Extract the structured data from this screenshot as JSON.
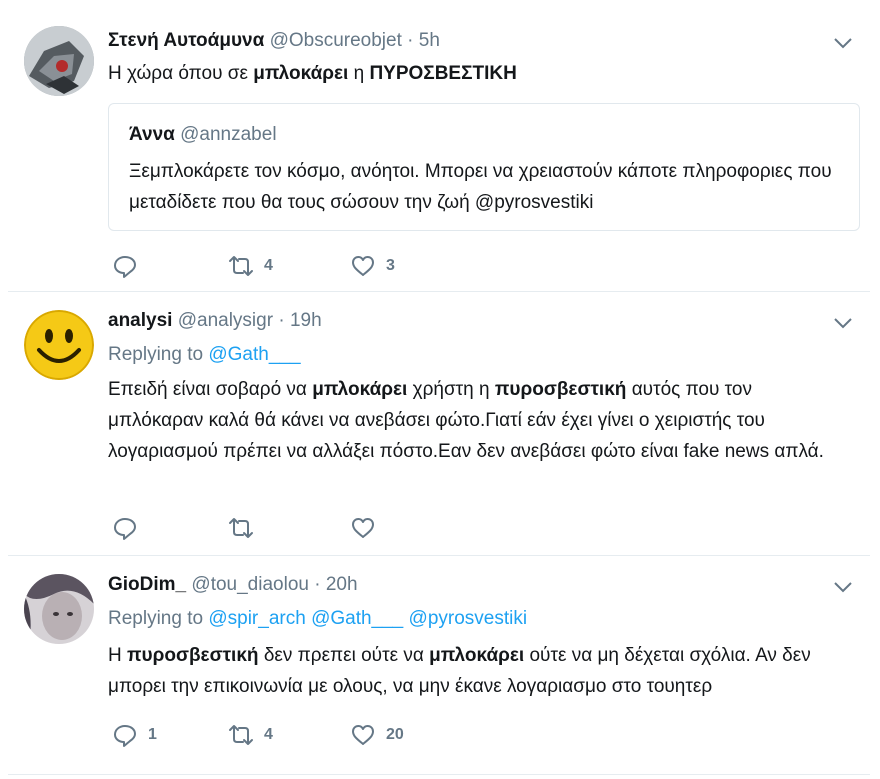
{
  "tweets": [
    {
      "name": "Στενή Αυτοάμυνα",
      "handle": "@Obscureobjet",
      "dot": "·",
      "time": "5h",
      "text_parts": [
        "Η χώρα όπου σε ",
        "μπλοκάρει",
        " η ",
        "ΠΥΡΟΣΒΕΣΤΙΚΗ"
      ],
      "quote": {
        "name": "Άννα",
        "handle": "@annzabel",
        "text": "Ξεμπλοκάρετε τον κόσμο, ανόητοι. Μπορει να χρειαστούν κάποτε πληροφοριες που μεταδίδετε που θα τους σώσουν την ζωή @pyrosvestiki"
      },
      "actions": {
        "reply_count": "",
        "retweet_count": "4",
        "like_count": "3"
      }
    },
    {
      "name": "analysi",
      "handle": "@analysigr",
      "dot": "·",
      "time": "19h",
      "replying_prefix": "Replying to",
      "replying_to": [
        "@Gath___"
      ],
      "text_parts": [
        "Επειδή είναι σοβαρό να ",
        "μπλοκάρει",
        " χρήστη η ",
        "πυροσβεστική",
        " αυτός που τον μπλόκαραν καλά θά κάνει να ανεβάσει φώτο.Γιατί εάν έχει γίνει ο χειριστής του λογαριασμού πρέπει να αλλάξει πόστο.Εαν δεν ανεβάσει φώτο είναι fake news απλά."
      ],
      "actions": {
        "reply_count": "",
        "retweet_count": "",
        "like_count": ""
      }
    },
    {
      "name": "GioDim_",
      "handle": "@tou_diaolou",
      "dot": "·",
      "time": "20h",
      "replying_prefix": "Replying to",
      "replying_to": [
        "@spir_arch",
        "@Gath___",
        "@pyrosvestiki"
      ],
      "text_parts": [
        "Η ",
        "πυροσβεστική",
        " δεν πρεπει ούτε να ",
        "μπλοκάρει",
        " ούτε να μη δέχεται σχόλια. Αν δεν μπορει την επικοινωνία με ολους, να μην έκανε λογαριασμο στο τουητερ"
      ],
      "actions": {
        "reply_count": "1",
        "retweet_count": "4",
        "like_count": "20"
      }
    }
  ],
  "icons": {
    "reply": "reply-icon",
    "retweet": "retweet-icon",
    "like": "heart-icon",
    "menu": "chevron-down-icon"
  },
  "colors": {
    "link": "#1da1f2",
    "secondary": "#657786",
    "text": "#14171a",
    "border": "#e1e8ed"
  }
}
